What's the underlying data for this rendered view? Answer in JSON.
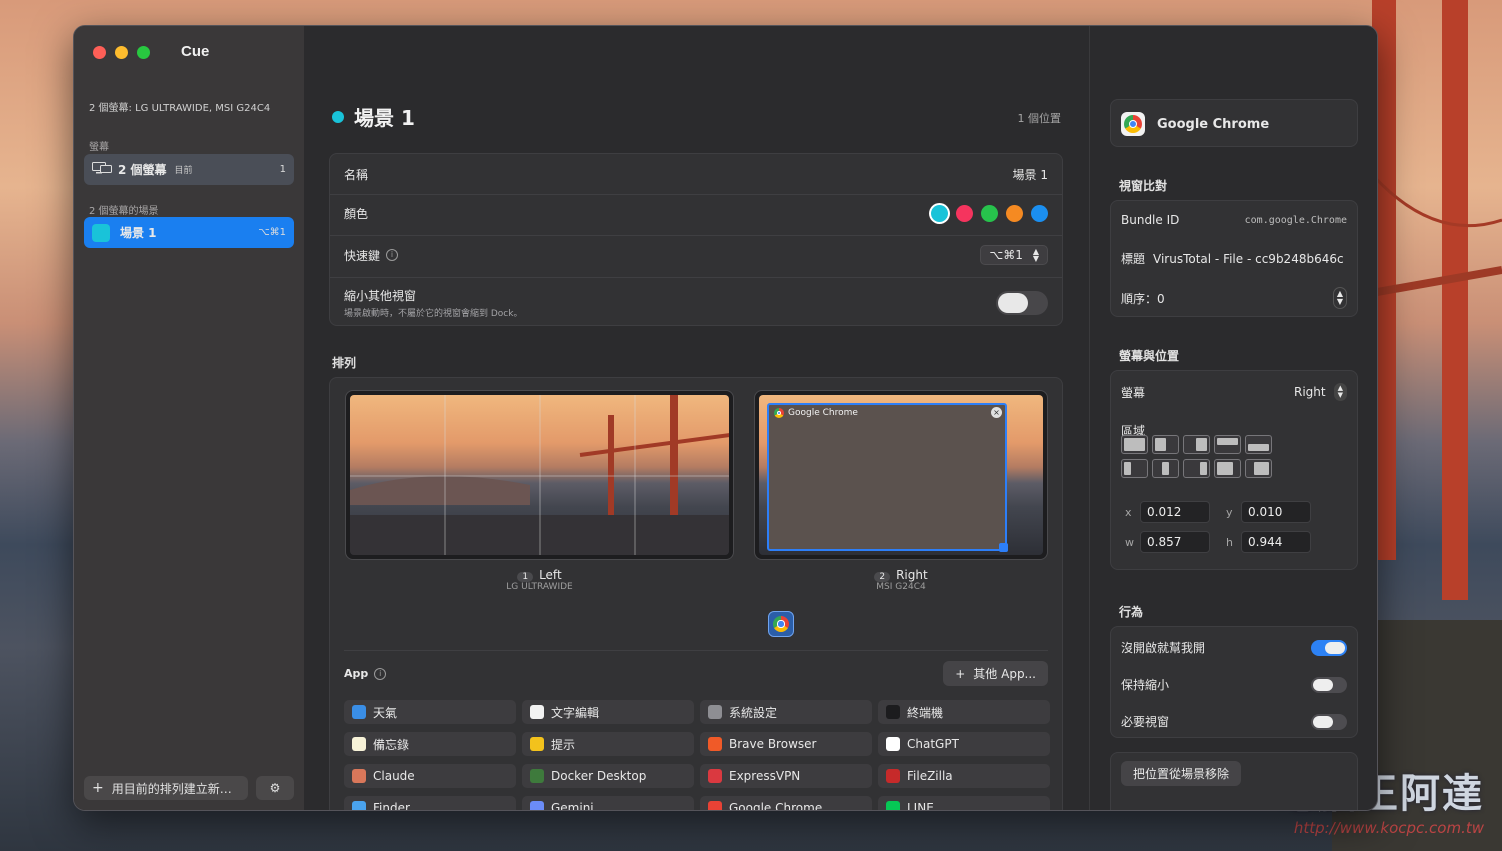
{
  "window": {
    "title": "Cue"
  },
  "sidebar": {
    "displays_info": "2 個螢幕: LG ULTRAWIDE, MSI G24C4",
    "screens_header": "螢幕",
    "screen_item": {
      "label": "2 個螢幕",
      "tag": "目前",
      "count": "1"
    },
    "scenes_header": "2 個螢幕的場景",
    "scene_item": {
      "label": "場景 1",
      "shortcut": "⌥⌘1"
    },
    "create_button": "用目前的排列建立新…"
  },
  "toolbar": {
    "icons": [
      "gear-icon",
      "resize-icon",
      "play-icon",
      "link-icon",
      "camera-icon",
      "undo-icon",
      "trash-icon"
    ]
  },
  "scene": {
    "title": "場景 1",
    "count": "1 個位置",
    "color": "#19c3d9"
  },
  "form": {
    "name_label": "名稱",
    "name_value": "場景 1",
    "color_label": "顏色",
    "colors": [
      "#19c3d9",
      "#f5345e",
      "#27c24c",
      "#f58a22",
      "#1b8ff0"
    ],
    "shortcut_label": "快速鍵",
    "shortcut_value": "⌥⌘1",
    "minimize_label": "縮小其他視窗",
    "minimize_note": "場景啟動時，不屬於它的視窗會縮到 Dock。"
  },
  "arrangement": {
    "label": "排列",
    "monitors": [
      {
        "index": "1",
        "name": "Left",
        "model": "LG ULTRAWIDE"
      },
      {
        "index": "2",
        "name": "Right",
        "model": "MSI G24C4"
      }
    ],
    "window_title": "Google Chrome",
    "close_glyph": "×"
  },
  "apps": {
    "label": "App",
    "other_button": "其他 App...",
    "items": [
      {
        "name": "天氣",
        "color": "#3a8ee6"
      },
      {
        "name": "文字編輯",
        "color": "#f2f2f2"
      },
      {
        "name": "系統設定",
        "color": "#8e8e93"
      },
      {
        "name": "終端機",
        "color": "#1c1c1e"
      },
      {
        "name": "備忘錄",
        "color": "#f7f2d8"
      },
      {
        "name": "提示",
        "color": "#f3c21c"
      },
      {
        "name": "Brave Browser",
        "color": "#f05a28"
      },
      {
        "name": "ChatGPT",
        "color": "#ffffff"
      },
      {
        "name": "Claude",
        "color": "#d9775a"
      },
      {
        "name": "Docker Desktop",
        "color": "#3e7a3c"
      },
      {
        "name": "ExpressVPN",
        "color": "#da3940"
      },
      {
        "name": "FileZilla",
        "color": "#c62a2a"
      },
      {
        "name": "Finder",
        "color": "#4aa3ee"
      },
      {
        "name": "Gemini",
        "color": "#6b8cf7"
      },
      {
        "name": "Google Chrome",
        "color": "#e94235"
      },
      {
        "name": "LINE",
        "color": "#06c755"
      }
    ]
  },
  "inspector": {
    "app_name": "Google Chrome",
    "match_header": "視窗比對",
    "bundle_label": "Bundle ID",
    "bundle_value": "com.google.Chrome",
    "title_label": "標題",
    "title_value": "VirusTotal - File - cc9b248b646c",
    "order_label": "順序：0",
    "display_header": "螢幕與位置",
    "screen_label": "螢幕",
    "screen_value": "Right",
    "region_label": "區域",
    "x_label": "x",
    "x_value": "0.012",
    "y_label": "y",
    "y_value": "0.010",
    "w_label": "w",
    "w_value": "0.857",
    "h_label": "h",
    "h_value": "0.944",
    "behavior_header": "行為",
    "open_label": "沒開啟就幫我開",
    "open_on": true,
    "keep_label": "保持縮小",
    "keep_on": false,
    "required_label": "必要視窗",
    "required_on": false,
    "remove_button": "把位置從場景移除"
  },
  "watermark": {
    "text": "電腦王阿達",
    "url": "http://www.kocpc.com.tw"
  }
}
